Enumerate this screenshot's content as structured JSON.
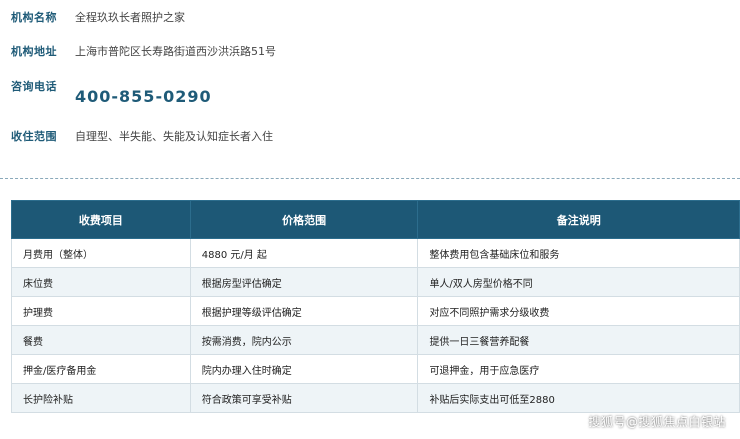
{
  "info": {
    "name_label": "机构名称",
    "name_value": "全程玖玖长者照护之家",
    "address_label": "机构地址",
    "address_value": "上海市普陀区长寿路街道西沙洪浜路51号",
    "phone_label": "咨询电话",
    "phone_value": "400-855-0290",
    "scope_label": "收住范围",
    "scope_value": "自理型、半失能、失能及认知症长者入住"
  },
  "table": {
    "headers": [
      "收费项目",
      "价格范围",
      "备注说明"
    ],
    "rows": [
      [
        "月费用（整体）",
        "4880 元/月 起",
        "整体费用包含基础床位和服务"
      ],
      [
        "床位费",
        "根据房型评估确定",
        "单人/双人房型价格不同"
      ],
      [
        "护理费",
        "根据护理等级评估确定",
        "对应不同照护需求分级收费"
      ],
      [
        "餐费",
        "按需消费，院内公示",
        "提供一日三餐营养配餐"
      ],
      [
        "押金/医疗备用金",
        "院内办理入住时确定",
        "可退押金，用于应急医疗"
      ],
      [
        "长护险补贴",
        "符合政策可享受补贴",
        "补贴后实际支出可低至2880"
      ]
    ]
  },
  "watermark": "搜狐号@搜狐焦点白银站"
}
